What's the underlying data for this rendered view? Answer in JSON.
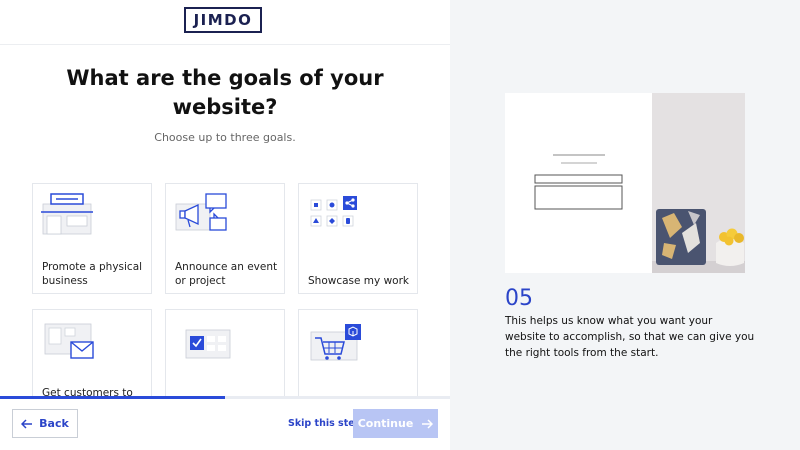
{
  "header": {
    "logo_text": "JIMDO"
  },
  "main": {
    "title": "What are the goals of your website?",
    "subtitle": "Choose up to three goals."
  },
  "goals": [
    {
      "label": "Promote a physical business",
      "icon": "storefront-icon"
    },
    {
      "label": "Announce an event or project",
      "icon": "megaphone-icon"
    },
    {
      "label": "Showcase my work",
      "icon": "portfolio-icon"
    },
    {
      "label": "Get customers to",
      "icon": "contact-mail-icon"
    },
    {
      "label": "",
      "icon": "booking-calendar-icon"
    },
    {
      "label": "",
      "icon": "shopping-cart-icon"
    }
  ],
  "progress": {
    "fraction": 0.5
  },
  "footer": {
    "back_label": "Back",
    "skip_label": "Skip this step",
    "continue_label": "Continue"
  },
  "side_panel": {
    "step_number": "05",
    "description": "This helps us know what you want your website to accomplish, so that we can give you the right tools from the start."
  },
  "colors": {
    "accent": "#2b44c8",
    "brand_dark": "#1b2151",
    "continue_disabled": "#b8c5f4"
  }
}
